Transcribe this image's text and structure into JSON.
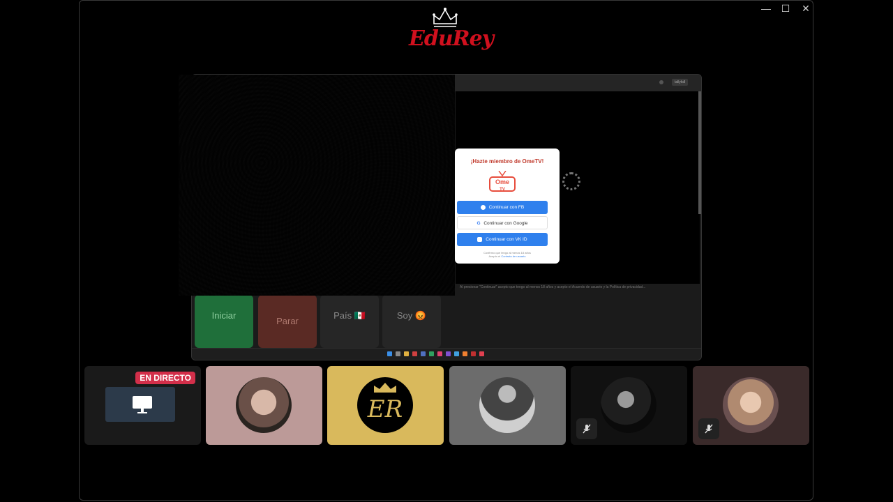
{
  "window": {
    "minimize": "—",
    "maximize": "☐",
    "close": "✕"
  },
  "logo": {
    "text": "EduRey"
  },
  "shared_screen": {
    "address_badge": "tallykdl",
    "caption": "Al presionar \"Continuar\" acepto que tengo al menos 18 años y acepto el Acuerdo de usuario y la Política de privacidad...",
    "buttons": {
      "start": "Iniciar",
      "stop": "Parar",
      "country": "País 🇲🇽",
      "gender": "Soy 😡"
    }
  },
  "modal": {
    "title": "¡Hazte miembro de OmeTV!",
    "logo_top": "Ome",
    "logo_bottom": "TV",
    "fb_button": "Continuar con FB",
    "google_button": "Continuar con Google",
    "vk_button": "Continuar con VK ID",
    "legal_line1": "Confirmo que tengo al menos 18 años",
    "legal_line2_prefix": "Acepto el",
    "legal_line2_link": "Contrato de usuario"
  },
  "participants": {
    "live_badge": "EN DIRECTO",
    "er_initials": "ER",
    "colors": {
      "tile1": "#1a1a1a",
      "tile2": "#bc9a98",
      "tile3": "#d9b95c",
      "tile4": "#6c6c6c",
      "tile5": "#111111",
      "tile6": "#3a2a2a"
    }
  }
}
